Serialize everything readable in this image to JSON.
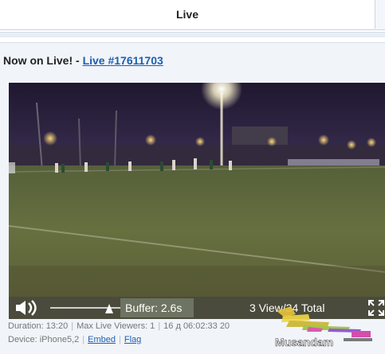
{
  "tabs": [
    {
      "label": "Live",
      "active": true
    }
  ],
  "heading": {
    "prefix": "Now on Live! - ",
    "link_text": "Live #17611703"
  },
  "video": {
    "description": "night football pitch under floodlights"
  },
  "controls": {
    "volume_icon": "speaker-icon",
    "volume_level": 0.78,
    "buffer_text": "Buffer: 2.6s",
    "views_text": "3 View/34 Total",
    "fullscreen_icon": "expand-icon"
  },
  "meta": {
    "duration": "Duration: 13:20",
    "max_viewers": "Max Live Viewers: 1",
    "timestamp": "16 д 06:02:33 20",
    "device": "Device: iPhone5,2",
    "embed": "Embed",
    "flag": "Flag"
  },
  "watermark": {
    "text": "Musandam"
  }
}
